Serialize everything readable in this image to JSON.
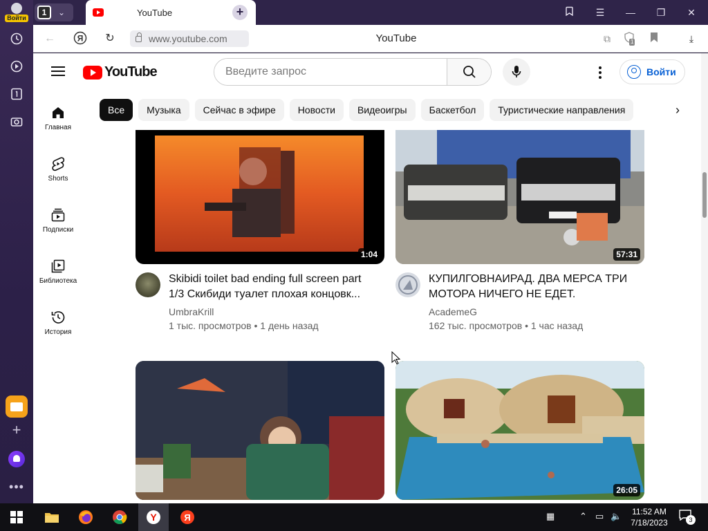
{
  "browser": {
    "login_label": "Войти",
    "tab_count": "1",
    "tab_title": "YouTube",
    "url": "www.youtube.com",
    "page_title": "YouTube",
    "bookmark_badge": "1"
  },
  "youtube": {
    "logo_text": "YouTube",
    "search_placeholder": "Введите запрос",
    "signin_label": "Войти",
    "chips": [
      "Все",
      "Музыка",
      "Сейчас в эфире",
      "Новости",
      "Видеоигры",
      "Баскетбол",
      "Туристические направления"
    ],
    "guide": [
      {
        "label": "Главная",
        "icon": "home-icon"
      },
      {
        "label": "Shorts",
        "icon": "shorts-icon"
      },
      {
        "label": "Подписки",
        "icon": "subscriptions-icon"
      },
      {
        "label": "Библиотека",
        "icon": "library-icon"
      },
      {
        "label": "История",
        "icon": "history-icon"
      }
    ],
    "videos": [
      {
        "title_line1": "Skibidi toilet bad ending full screen part",
        "title_line2": "1/3 Скибиди туалет плохая концовк...",
        "channel": "UmbraKrill",
        "stats": "1 тыс. просмотров • 1 день назад",
        "duration": "1:04"
      },
      {
        "title_line1": "КУПИЛГОВНАИРАД. ДВА МЕРСА ТРИ",
        "title_line2": "МОТОРА НИЧЕГО НЕ ЕДЕТ.",
        "channel": "AcademeG",
        "stats": "162 тыс. просмотров • 1 час назад",
        "duration": "57:31"
      },
      {
        "title_line1": "",
        "title_line2": "",
        "channel": "",
        "stats": "",
        "duration": ""
      },
      {
        "title_line1": "",
        "title_line2": "",
        "channel": "",
        "stats": "",
        "duration": "26:05"
      }
    ]
  },
  "taskbar": {
    "time": "11:52 AM",
    "date": "7/18/2023",
    "notification_count": "3"
  },
  "colors": {
    "yt_red": "#ff0000",
    "link_blue": "#065fd4",
    "sidebar_purple": "#2c2048"
  }
}
